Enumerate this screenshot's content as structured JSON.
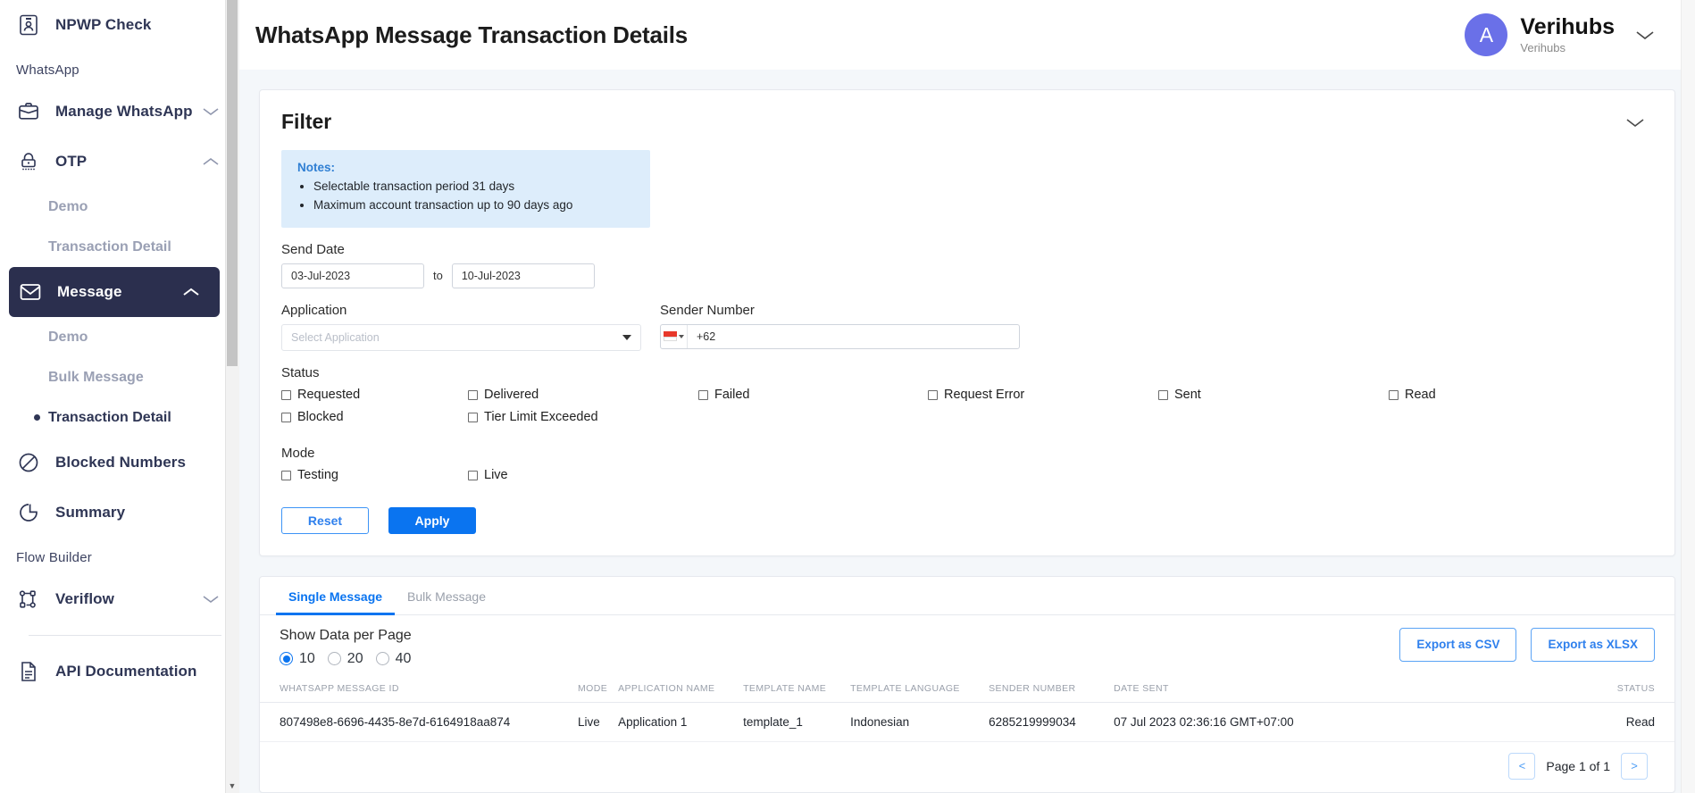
{
  "sidebar": {
    "top_item": {
      "label": "NPWP Check",
      "icon": "id-card-icon"
    },
    "groups": [
      {
        "title": "WhatsApp",
        "items": [
          {
            "label": "Manage WhatsApp",
            "icon": "briefcase-icon",
            "chevron": "down",
            "active": false,
            "subitems": []
          },
          {
            "label": "OTP",
            "icon": "lock-keypad-icon",
            "chevron": "up",
            "active": false,
            "subitems": [
              {
                "label": "Demo",
                "selected": false
              },
              {
                "label": "Transaction Detail",
                "selected": false
              }
            ]
          },
          {
            "label": "Message",
            "icon": "envelope-icon",
            "chevron": "up",
            "active": true,
            "subitems": [
              {
                "label": "Demo",
                "selected": false
              },
              {
                "label": "Bulk Message",
                "selected": false
              },
              {
                "label": "Transaction Detail",
                "selected": true
              }
            ]
          },
          {
            "label": "Blocked Numbers",
            "icon": "no-entry-icon",
            "chevron": "",
            "active": false,
            "subitems": []
          },
          {
            "label": "Summary",
            "icon": "pie-chart-icon",
            "chevron": "",
            "active": false,
            "subitems": []
          }
        ]
      },
      {
        "title": "Flow Builder",
        "items": [
          {
            "label": "Veriflow",
            "icon": "flow-nodes-icon",
            "chevron": "down",
            "active": false,
            "subitems": []
          }
        ]
      }
    ],
    "footer_item": {
      "label": "API Documentation",
      "icon": "document-icon"
    }
  },
  "header": {
    "page_title": "WhatsApp Message Transaction Details",
    "avatar_initial": "A",
    "user_name": "Verihubs",
    "user_org": "Verihubs",
    "chevron_icon": "chevron-down-icon"
  },
  "filter": {
    "title": "Filter",
    "collapse_icon": "chevron-down-icon",
    "notes_title": "Notes:",
    "notes": [
      "Selectable transaction period 31 days",
      "Maximum account transaction up to 90 days ago"
    ],
    "send_date_label": "Send Date",
    "date_from": "03-Jul-2023",
    "date_to_word": "to",
    "date_to": "10-Jul-2023",
    "application_label": "Application",
    "application_placeholder": "Select Application",
    "application_value": "",
    "sender_number_label": "Sender Number",
    "sender_country_flag": "indonesia-flag-icon",
    "sender_number_value": "+62",
    "status_label": "Status",
    "status_options_col1": [
      "Requested",
      "Blocked"
    ],
    "status_options_col2": [
      "Delivered",
      "Tier Limit Exceeded"
    ],
    "status_options_col3": [
      "Failed"
    ],
    "status_options_col4": [
      "Request Error"
    ],
    "status_options_col5": [
      "Sent"
    ],
    "status_options_col6": [
      "Read"
    ],
    "mode_label": "Mode",
    "mode_options_col1": [
      "Testing"
    ],
    "mode_options_col2": [
      "Live"
    ],
    "reset_label": "Reset",
    "apply_label": "Apply"
  },
  "table_panel": {
    "tabs": [
      {
        "label": "Single Message",
        "active": true
      },
      {
        "label": "Bulk Message",
        "active": false
      }
    ],
    "per_page_label": "Show Data per Page",
    "per_page_options": [
      {
        "label": "10",
        "selected": true
      },
      {
        "label": "20",
        "selected": false
      },
      {
        "label": "40",
        "selected": false
      }
    ],
    "export_csv_label": "Export as CSV",
    "export_xlsx_label": "Export as XLSX",
    "columns": [
      "WHATSAPP MESSAGE ID",
      "MODE",
      "APPLICATION NAME",
      "TEMPLATE NAME",
      "TEMPLATE LANGUAGE",
      "SENDER NUMBER",
      "DATE SENT",
      "STATUS"
    ],
    "rows": [
      {
        "message_id": "807498e8-6696-4435-8e7d-6164918aa874",
        "mode": "Live",
        "application_name": "Application 1",
        "template_name": "template_1",
        "template_language": "Indonesian",
        "sender_number": "6285219999034",
        "date_sent": "07 Jul 2023 02:36:16 GMT+07:00",
        "status": "Read"
      }
    ],
    "pager": {
      "prev_label": "<",
      "page_label": "Page 1 of 1",
      "next_label": ">"
    }
  },
  "colors": {
    "accent_blue": "#0a74f0",
    "sidebar_active": "#2b2f4e",
    "notes_bg": "#ddedfb",
    "content_bg": "#f4f7fa",
    "avatar_bg": "#6a70e8"
  }
}
